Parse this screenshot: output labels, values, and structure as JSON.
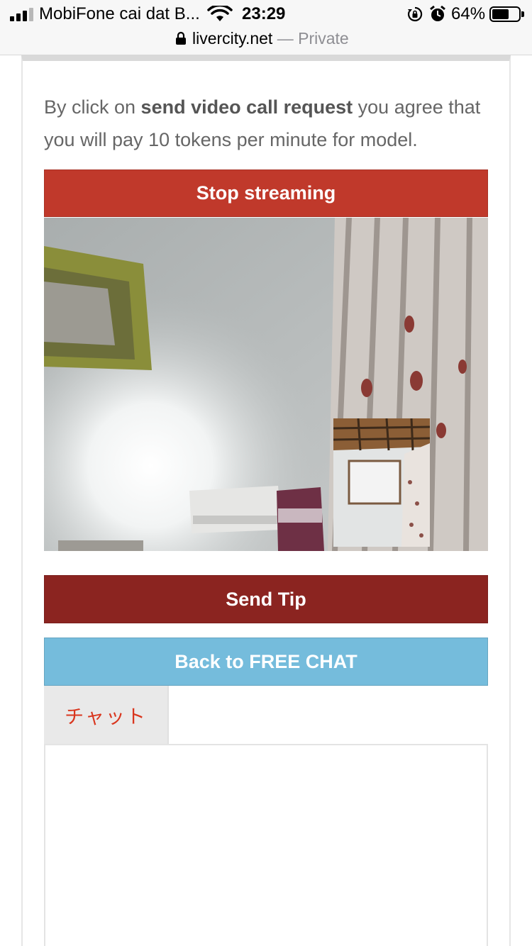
{
  "status_bar": {
    "carrier": "MobiFone cai dat B...",
    "time": "23:29",
    "battery_percent": "64%",
    "battery_level": 0.64,
    "icons": [
      "signal-icon",
      "wifi-icon",
      "rotation-lock-icon",
      "alarm-icon",
      "battery-icon"
    ]
  },
  "url_bar": {
    "domain": "livercity.net",
    "separator": " — ",
    "mode": "Private"
  },
  "notice": {
    "prefix": "By click on ",
    "bold": "send video call request",
    "suffix": " you agree that you will pay 10 tokens per minute for model."
  },
  "buttons": {
    "stop_streaming": "Stop streaming",
    "send_tip": "Send Tip",
    "back_free_chat": "Back to FREE CHAT"
  },
  "chat": {
    "tab_label": "チャット"
  },
  "colors": {
    "stop_button": "#c0392b",
    "tip_button": "#8b2420",
    "back_button": "#75bcdc",
    "chat_tab_text": "#d9361e"
  }
}
